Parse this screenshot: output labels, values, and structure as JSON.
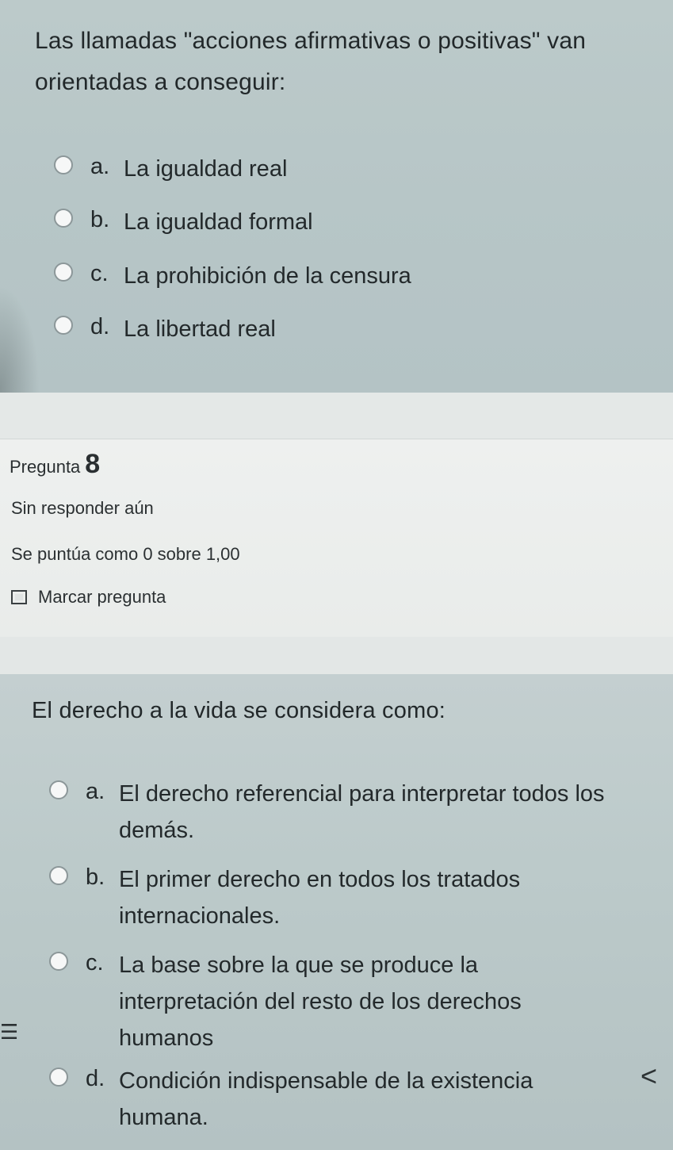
{
  "question7": {
    "text": "Las llamadas \"acciones afirmativas o positivas\" van orientadas a conseguir:",
    "options": [
      {
        "letter": "a.",
        "text": "La igualdad real"
      },
      {
        "letter": "b.",
        "text": "La igualdad formal"
      },
      {
        "letter": "c.",
        "text": "La prohibición de la censura"
      },
      {
        "letter": "d.",
        "text": "La libertad real"
      }
    ]
  },
  "question8_info": {
    "label": "Pregunta",
    "number": "8",
    "status": "Sin responder aún",
    "score": "Se puntúa como 0 sobre 1,00",
    "flag_label": "Marcar pregunta"
  },
  "question8": {
    "text": "El derecho a la vida se considera como:",
    "options": [
      {
        "letter": "a.",
        "text": "El derecho referencial para interpretar todos los demás."
      },
      {
        "letter": "b.",
        "text": "El primer derecho en todos los tratados internacionales."
      },
      {
        "letter": "c.",
        "text": "La base sobre la que se produce la interpretación del resto de los derechos humanos"
      },
      {
        "letter": "d.",
        "text": "Condición indispensable de la existencia humana."
      }
    ]
  },
  "icons": {
    "list": "list-icon",
    "nav_prev": "chevron-left-icon"
  },
  "glyphs": {
    "list": "☰",
    "chevron": "<"
  },
  "colors": {
    "question_bg": "#b9c6c6",
    "info_bg": "#eceeed",
    "text": "#22282a"
  }
}
